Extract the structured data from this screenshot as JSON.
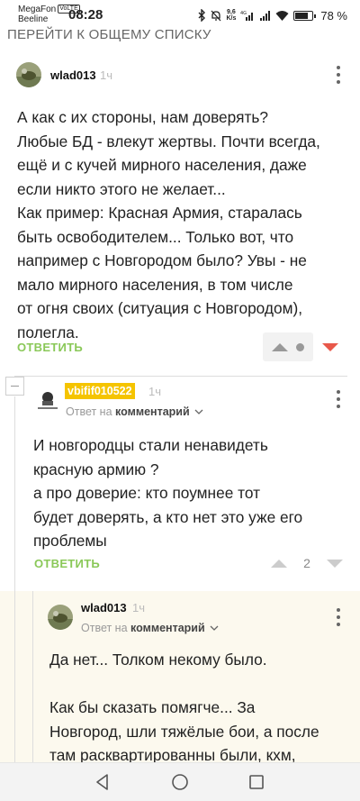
{
  "status_bar": {
    "carrier_1": "MegaFon",
    "volte": "VoLTE",
    "carrier_2": "Beeline",
    "time": "08:28",
    "net_speed_value": "9,6",
    "net_speed_unit": "K/s",
    "battery_text": "78 %",
    "battery_level": 0.78
  },
  "back_link": "ПЕРЕЙТИ К ОБЩЕМУ СПИСКУ",
  "comments": [
    {
      "author": "wlad013",
      "time": "1ч",
      "lines": [
        "А как с их стороны, нам доверять?",
        "Любые БД - влекут жертвы. Почти всегда,",
        "ещё и с кучей мирного населения, даже",
        "если никто этого не желает...",
        "Как пример: Красная Армия, старалась",
        "быть освободителем... Только вот, что",
        "например с Новгородом было? Увы - не",
        "мало мирного населения, в том числе",
        "от огня своих (ситуация с Новгородом),",
        "полегла."
      ],
      "reply_label": "ОТВЕТИТЬ"
    },
    {
      "author": "vbifif010522",
      "time": "1ч",
      "reply_to_prefix": "Ответ на",
      "reply_to_target": "комментарий",
      "lines": [
        "И новгородцы стали ненавидеть",
        "красную армию ?",
        "а про доверие: кто поумнее тот",
        "будет доверять, а кто нет это уже его",
        "проблемы"
      ],
      "reply_label": "ОТВЕТИТЬ",
      "rating": "2"
    },
    {
      "author": "wlad013",
      "time": "1ч",
      "reply_to_prefix": "Ответ на",
      "reply_to_target": "комментарий",
      "lines": [
        "Да нет... Толком некому было.",
        "",
        "Как бы сказать помягче... За",
        "Новгород, шли тяжёлые бои, а после",
        "там расквартированны были, кхм,"
      ]
    }
  ],
  "icons": {
    "vote_up": "triangle-up-icon",
    "vote_down": "triangle-down-icon",
    "more": "vertical-dots-icon",
    "collapse": "minus-icon",
    "nav_back": "triangle-back-icon",
    "nav_home": "circle-home-icon",
    "nav_recent": "square-recent-icon"
  },
  "colors": {
    "reply_green": "#8ac858",
    "downvote_red": "#e8584a",
    "author_badge": "#f5c400",
    "highlight_bg": "#fcf9ee"
  }
}
